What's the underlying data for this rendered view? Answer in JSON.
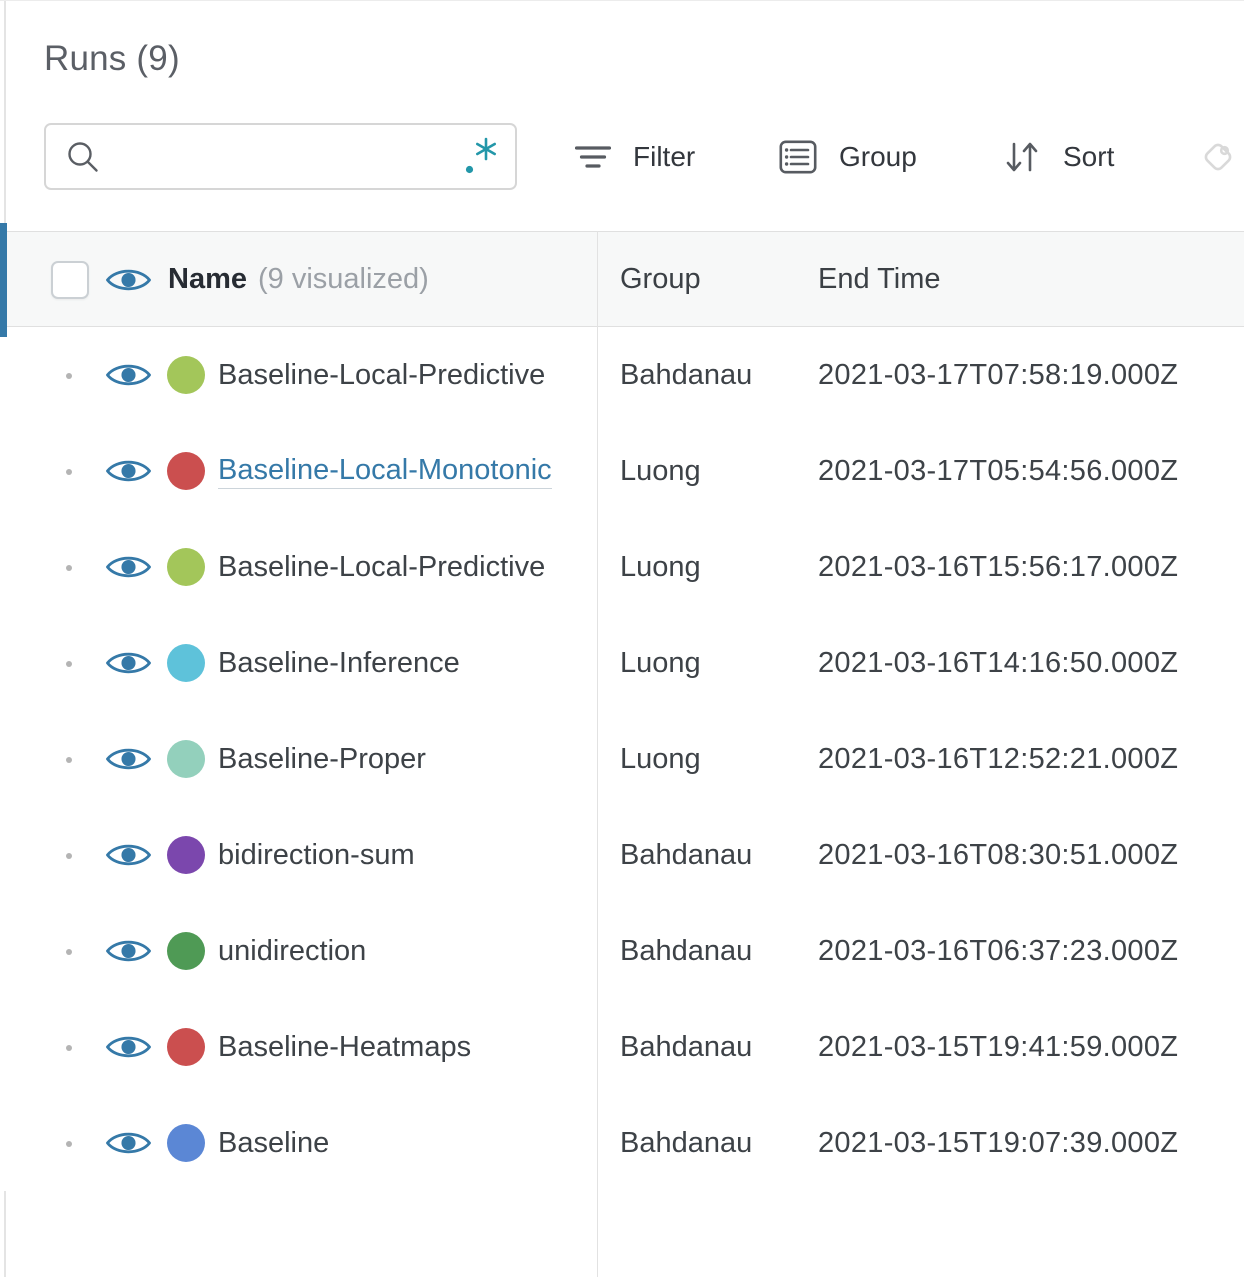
{
  "panel": {
    "title": "Runs (9)"
  },
  "search": {
    "value": "",
    "placeholder": ""
  },
  "toolbar": {
    "filter_label": "Filter",
    "group_label": "Group",
    "sort_label": "Sort"
  },
  "table": {
    "header": {
      "name": "Name",
      "name_note": "(9 visualized)",
      "group": "Group",
      "end_time": "End Time"
    },
    "rows": [
      {
        "name": "Baseline-Local-Predictive",
        "color": "#a3c65a",
        "group": "Bahdanau",
        "end_time": "2021-03-17T07:58:19.000Z",
        "visualized": true,
        "link": false
      },
      {
        "name": "Baseline-Local-Monotonic",
        "color": "#cb4f4f",
        "group": "Luong",
        "end_time": "2021-03-17T05:54:56.000Z",
        "visualized": true,
        "link": true
      },
      {
        "name": "Baseline-Local-Predictive",
        "color": "#a3c65a",
        "group": "Luong",
        "end_time": "2021-03-16T15:56:17.000Z",
        "visualized": true,
        "link": false
      },
      {
        "name": "Baseline-Inference",
        "color": "#5ec2da",
        "group": "Luong",
        "end_time": "2021-03-16T14:16:50.000Z",
        "visualized": true,
        "link": false
      },
      {
        "name": "Baseline-Proper",
        "color": "#93d0bc",
        "group": "Luong",
        "end_time": "2021-03-16T12:52:21.000Z",
        "visualized": true,
        "link": false
      },
      {
        "name": "bidirection-sum",
        "color": "#7b47ad",
        "group": "Bahdanau",
        "end_time": "2021-03-16T08:30:51.000Z",
        "visualized": true,
        "link": false
      },
      {
        "name": "unidirection",
        "color": "#4f9a55",
        "group": "Bahdanau",
        "end_time": "2021-03-16T06:37:23.000Z",
        "visualized": true,
        "link": false
      },
      {
        "name": "Baseline-Heatmaps",
        "color": "#cb4f4f",
        "group": "Bahdanau",
        "end_time": "2021-03-15T19:41:59.000Z",
        "visualized": true,
        "link": false
      },
      {
        "name": "Baseline",
        "color": "#5b87d5",
        "group": "Bahdanau",
        "end_time": "2021-03-15T19:07:39.000Z",
        "visualized": true,
        "link": false
      }
    ]
  },
  "colors": {
    "accent_blue": "#3579a8",
    "link_blue": "#3579a8",
    "eye_blue": "#3579a8",
    "regex_teal": "#2397a9"
  }
}
